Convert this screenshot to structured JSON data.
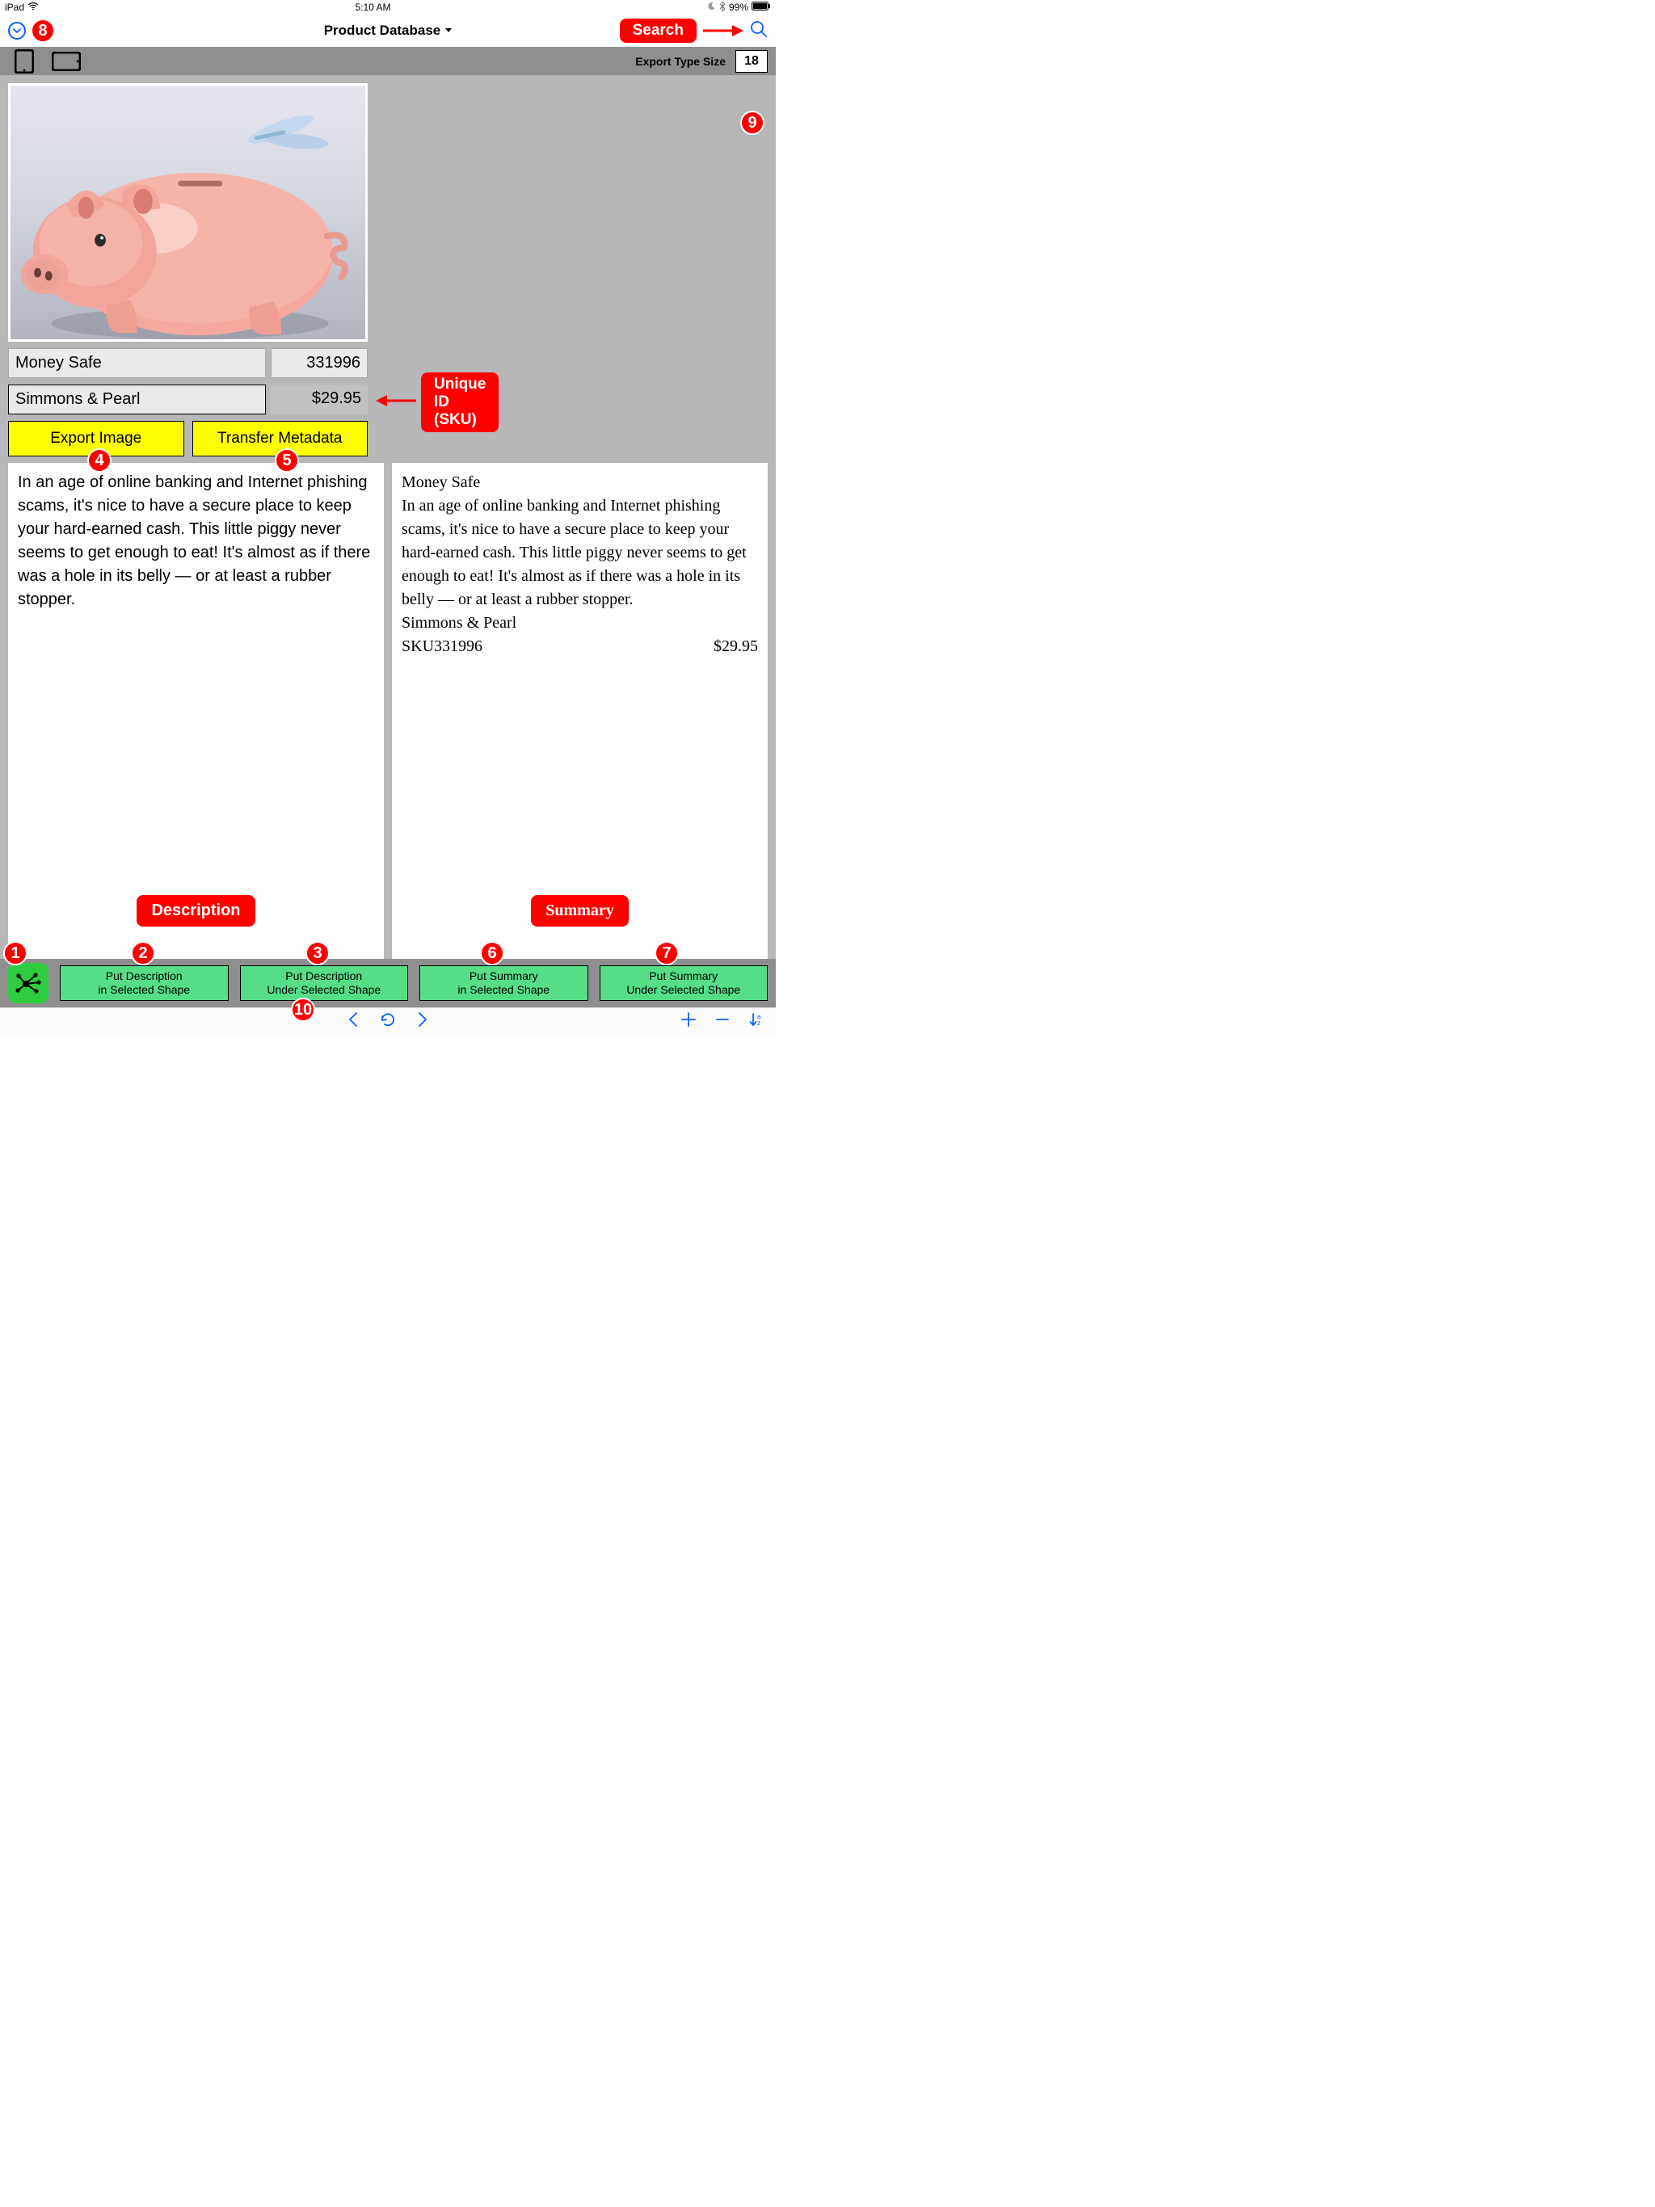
{
  "status": {
    "carrier": "iPad",
    "time": "5:10 AM",
    "battery": "99%"
  },
  "header": {
    "title": "Product Database"
  },
  "callouts": {
    "search": "Search",
    "sku": "Unique ID (SKU)"
  },
  "toolbar": {
    "export_type_label": "Export Type Size",
    "export_type_value": "18"
  },
  "product": {
    "name": "Money Safe",
    "sku": "331996",
    "company": "Simmons & Pearl",
    "price": "$29.95",
    "description": "In an age of online banking and Internet phishing scams, it's nice to have a secure place to keep your hard-earned cash. This little piggy never seems to get enough to eat! It's almost as if there was a hole in its belly — or at least a rubber stopper."
  },
  "summary": {
    "title": "Money Safe",
    "body": "In an age of online banking and Internet phishing scams, it's nice to have a secure place to keep your hard-earned cash. This little piggy never seems to get enough to eat! It's almost as if there was a hole in its belly — or at least a rubber stopper.",
    "company": "Simmons & Pearl",
    "sku_line": "SKU331996",
    "price": "$29.95"
  },
  "actions": {
    "export_image": "Export Image",
    "transfer_metadata": "Transfer Metadata",
    "desc_label": "Description",
    "summ_label": "Summary"
  },
  "bottom_buttons": {
    "b2a": "Put Description",
    "b2b": "in Selected Shape",
    "b3a": "Put Description",
    "b3b": "Under Selected Shape",
    "b6a": "Put Summary",
    "b6b": "in Selected Shape",
    "b7a": "Put Summary",
    "b7b": "Under Selected Shape"
  },
  "badges": {
    "n1": "1",
    "n2": "2",
    "n3": "3",
    "n4": "4",
    "n5": "5",
    "n6": "6",
    "n7": "7",
    "n8": "8",
    "n9": "9",
    "n10": "10"
  }
}
